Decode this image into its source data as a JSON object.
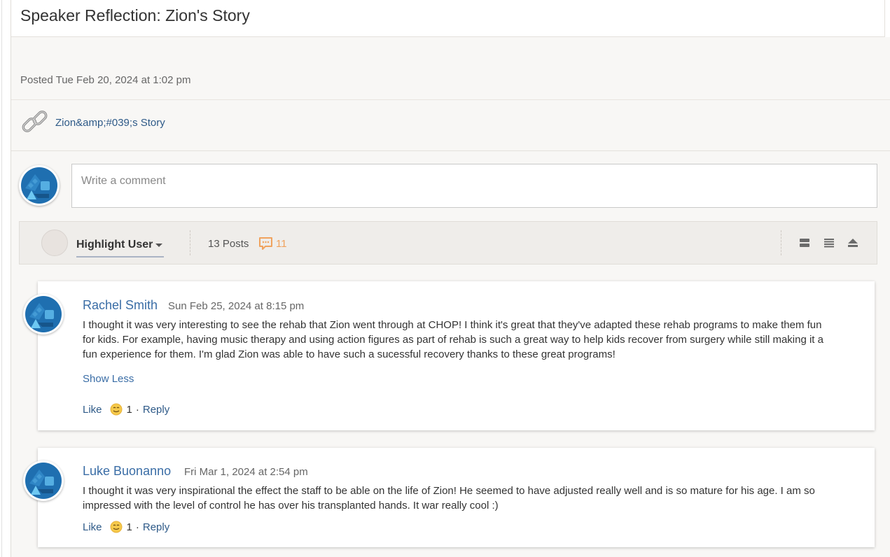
{
  "post": {
    "title": "Speaker Reflection: Zion's Story",
    "posted": "Posted Tue Feb 20, 2024 at 1:02 pm",
    "attachment_label": "Zion&amp;#039;s Story"
  },
  "composer": {
    "placeholder": "Write a comment"
  },
  "toolbar": {
    "highlight_label": "Highlight User",
    "posts_count": "13 Posts",
    "comment_count": "11",
    "icons": [
      "card-view-icon",
      "list-view-icon",
      "collapse-icon"
    ]
  },
  "comments": [
    {
      "author": "Rachel Smith",
      "date": "Sun Feb 25, 2024 at 8:15 pm",
      "body": "I thought it was very interesting to see the rehab that Zion went through at CHOP! I think it's great that they've adapted these rehab programs to make them fun for kids. For example, having music therapy and using action figures as part of rehab is such a great way to help kids recover from surgery while still making it a fun experience for them. I'm glad Zion was able to have such a sucessful recovery thanks to these great programs!",
      "show_less": "Show Less",
      "like": "Like",
      "reaction_count": "1",
      "separator": "·",
      "reply": "Reply"
    },
    {
      "author": "Luke Buonanno",
      "date": "Fri Mar 1, 2024 at 2:54 pm",
      "body": "I thought it was very inspirational the effect the staff to be able on the life of Zion! He seemed to have adjusted really well and is so mature for his age. I am so impressed with the level of control he has over his transplanted hands. It war really cool :)",
      "like": "Like",
      "reaction_count": "1",
      "separator": "·",
      "reply": "Reply"
    }
  ],
  "colors": {
    "accent": "#3a6da6",
    "comment_count": "#f0a35e",
    "panel_bg": "#f8f7f5"
  }
}
